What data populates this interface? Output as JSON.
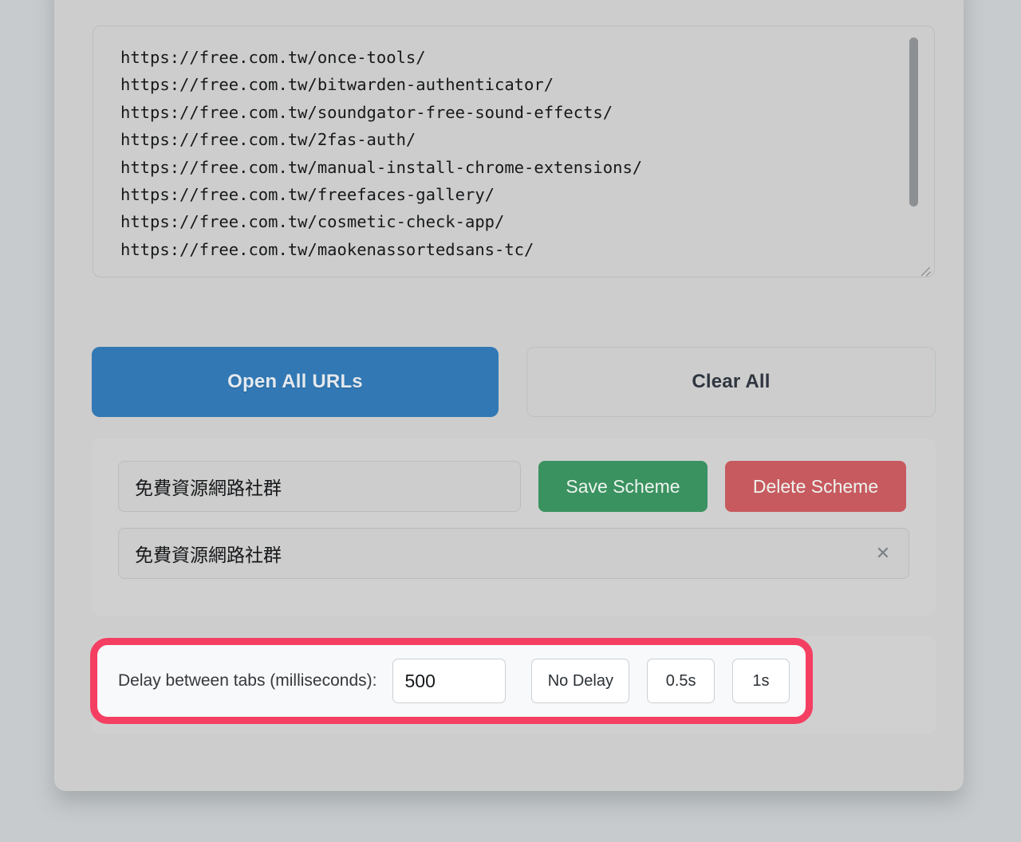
{
  "urls": {
    "value": "https://free.com.tw/once-tools/\nhttps://free.com.tw/bitwarden-authenticator/\nhttps://free.com.tw/soundgator-free-sound-effects/\nhttps://free.com.tw/2fas-auth/\nhttps://free.com.tw/manual-install-chrome-extensions/\nhttps://free.com.tw/freefaces-gallery/\nhttps://free.com.tw/cosmetic-check-app/\nhttps://free.com.tw/maokenassortedsans-tc/",
    "placeholder": "",
    "lines": [
      "https://free.com.tw/once-tools/",
      "https://free.com.tw/bitwarden-authenticator/",
      "https://free.com.tw/soundgator-free-sound-effects/",
      "https://free.com.tw/2fas-auth/",
      "https://free.com.tw/manual-install-chrome-extensions/",
      "https://free.com.tw/freefaces-gallery/",
      "https://free.com.tw/cosmetic-check-app/",
      "https://free.com.tw/maokenassortedsans-tc/"
    ]
  },
  "actions": {
    "open_all_label": "Open All URLs",
    "clear_all_label": "Clear All",
    "open_all_color": "#3178b4",
    "clear_all_color": "#cdcdcd"
  },
  "scheme": {
    "name_value": "免費資源網路社群",
    "name_placeholder": "",
    "save_label": "Save Scheme",
    "delete_label": "Delete Scheme",
    "save_color": "#3a9260",
    "delete_color": "#c75a5f",
    "list": [
      {
        "label": "免費資源網路社群",
        "remove_icon": "close-icon",
        "remove_glyph": "✕"
      }
    ]
  },
  "delay": {
    "label": "Delay between tabs (milliseconds):",
    "value": "500",
    "placeholder": "",
    "presets": [
      {
        "label": "No Delay"
      },
      {
        "label": "0.5s"
      },
      {
        "label": "1s"
      }
    ],
    "highlight_color": "#f43f63"
  }
}
